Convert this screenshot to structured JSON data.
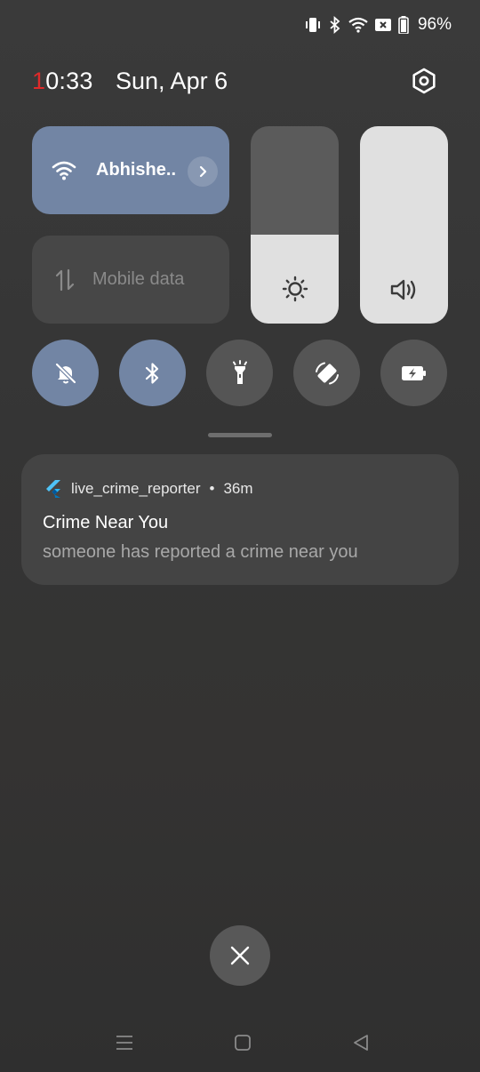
{
  "status_bar": {
    "battery_percent": "96%",
    "icons": [
      "vibrate-icon",
      "bluetooth-icon",
      "wifi-icon",
      "sim-off-icon",
      "battery-icon"
    ]
  },
  "header": {
    "time_first_digit": "1",
    "time_rest": "0:33",
    "date": "Sun, Apr 6",
    "settings_icon": "settings-hexagon-icon"
  },
  "tiles": {
    "wifi": {
      "label": "Abhishe..",
      "state": "on",
      "icon": "wifi-icon"
    },
    "mobile_data": {
      "label": "Mobile data",
      "state": "off",
      "icon": "mobile-data-arrows-icon"
    }
  },
  "sliders": {
    "brightness": {
      "level": 0.45,
      "icon": "sun-icon"
    },
    "volume": {
      "level": 1.0,
      "icon": "speaker-icon"
    }
  },
  "toggles": [
    {
      "name": "silent",
      "icon": "bell-off-icon",
      "state": "on"
    },
    {
      "name": "bluetooth",
      "icon": "bluetooth-icon",
      "state": "on"
    },
    {
      "name": "flashlight",
      "icon": "flashlight-icon",
      "state": "off"
    },
    {
      "name": "auto-rotate",
      "icon": "rotate-icon",
      "state": "off"
    },
    {
      "name": "battery-saver",
      "icon": "battery-charging-icon",
      "state": "off"
    }
  ],
  "notification": {
    "app_name": "live_crime_reporter",
    "separator": "•",
    "time_ago": "36m",
    "title": "Crime Near You",
    "body": "someone has reported a crime near you",
    "app_icon": "flutter-logo-icon"
  },
  "colors": {
    "tile_on": "#7285a4",
    "tile_off": "#474747",
    "accent_red": "#e02a2a"
  }
}
